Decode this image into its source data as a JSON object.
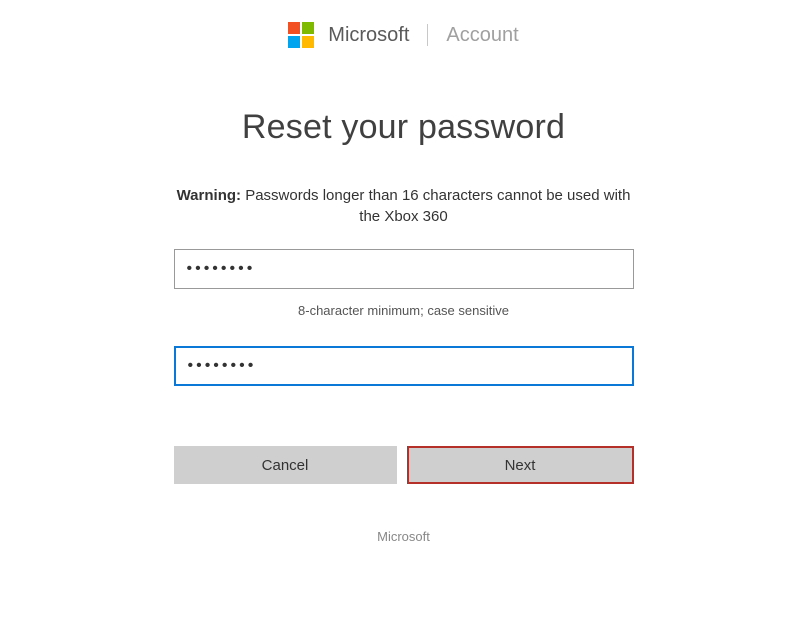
{
  "header": {
    "brand": "Microsoft",
    "section": "Account"
  },
  "title": "Reset your password",
  "warning": {
    "label": "Warning:",
    "text": "Passwords longer than 16 characters cannot be used with the Xbox 360"
  },
  "password_field": {
    "value": "••••••••",
    "hint": "8-character minimum; case sensitive"
  },
  "confirm_field": {
    "value": "••••••••"
  },
  "buttons": {
    "cancel": "Cancel",
    "next": "Next"
  },
  "footer": {
    "text": "Microsoft"
  }
}
